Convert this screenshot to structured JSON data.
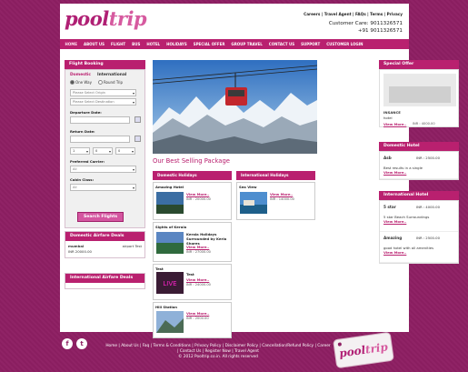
{
  "logo": {
    "part1": "pool",
    "part2": "trip"
  },
  "toplinks": "Careers | Travel Agent | FAQs | Terms | Privacy",
  "care": {
    "line1": "Customer Care: 9011326571",
    "line2": "+91 9011326571"
  },
  "nav": [
    "HOME",
    "ABOUT US",
    "FLIGHT",
    "BUS",
    "HOTEL",
    "HOLIDAYS",
    "SPECIAL OFFER",
    "GROUP TRAVEL",
    "CONTACT US",
    "SUPPORT",
    "CUSTOMER LOGIN"
  ],
  "booking": {
    "title": "Flight Booking",
    "tabs": [
      "Domestic",
      "International"
    ],
    "radios": [
      "One Way",
      "Round Trip"
    ],
    "origin": "Please Select Origin",
    "destination": "Please Select Destination",
    "departure_label": "Departure Date:",
    "return_label": "Return Date:",
    "adults": "1",
    "children": "0",
    "infants": "0",
    "carrier_label": "Preferred Carrier:",
    "carrier_value": "All",
    "cabin_label": "Cabin Class:",
    "cabin_value": "All",
    "search": "Search Flights"
  },
  "domestic_airfare": {
    "title": "Domestic Airfare Deals",
    "route": "mumbai",
    "to": "airport Test",
    "price": "INR 20000.00"
  },
  "intl_airfare": {
    "title": "International Airfare Deals"
  },
  "center": {
    "heading": "Our Best Selling Package",
    "domestic_title": "Domestic Holidays",
    "international_title": "International Holidays",
    "domestic": [
      {
        "title": "Amazing Hotel",
        "view": "View More..",
        "price": "INR : 20000.00"
      },
      {
        "title": "Sights of Kerala",
        "desc": "Kerala Holidays Surrounded by Kerla Shores",
        "view": "View More..",
        "price": "INR : 27000.00"
      },
      {
        "title": "Test",
        "desc": "Test",
        "view": "View More..",
        "price": "INR : 24000.00"
      },
      {
        "title": "Hill Station",
        "view": "View More..",
        "price": "INR : 2000.00"
      }
    ],
    "international": [
      {
        "title": "Sea View",
        "view": "View More..",
        "price": "INR : 14000.00"
      }
    ]
  },
  "right": {
    "special_title": "Special Offer",
    "special": {
      "name": "INSANCE",
      "sub": "hotel",
      "view": "View More..",
      "price": "INR : 4000.00"
    },
    "domestic_hotel_title": "Domestic Hotel",
    "domestic_hotel": {
      "name": "Asb",
      "amt": "INR : 2500.00",
      "desc": "Best results in a single",
      "view": "View More.."
    },
    "intl_hotel_title": "International Hotel",
    "intl_hotels": [
      {
        "name": "5 star",
        "amt": "INR : 4000.00",
        "desc": "5 star Beach Surroundings",
        "view": "View More.."
      },
      {
        "name": "Amazing",
        "amt": "INR : 2500.00",
        "desc": "good hotel with all amenities",
        "view": "View More.."
      }
    ]
  },
  "social": [
    "f",
    "t"
  ],
  "footer": {
    "line1": "Home | About Us | Faq | Terms & Conditions | Privacy Policy | Disclaimer Policy | Cancellation/Refund Policy | Career",
    "line2": "| Contact Us | Register Now | Travel Agent",
    "line3": "© 2012 Pooltrip.co.in. All rights reserved"
  },
  "colors": {
    "brand": "#b9206f",
    "background": "#8e1f63"
  }
}
